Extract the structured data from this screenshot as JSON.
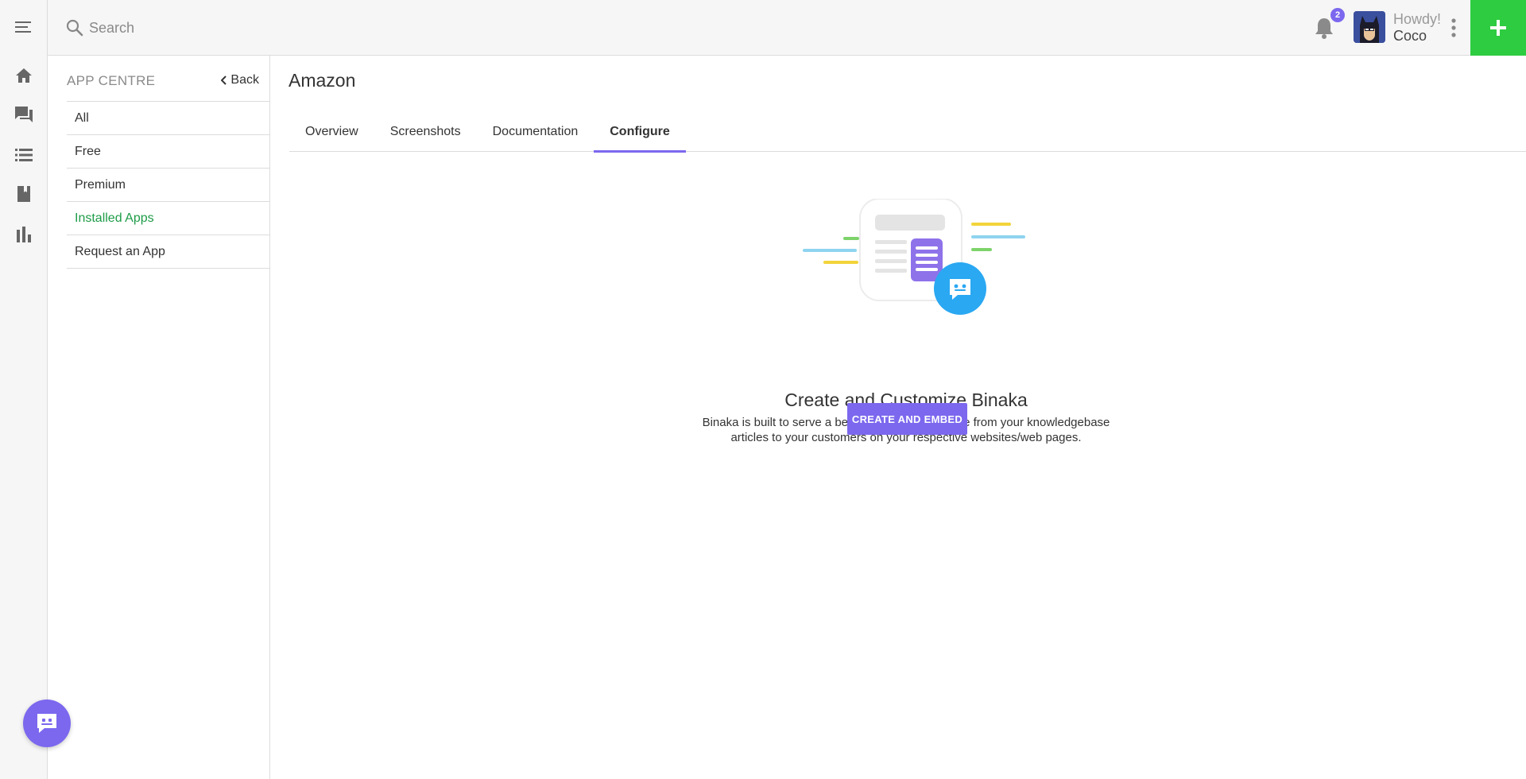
{
  "topbar": {
    "search_placeholder": "Search",
    "notification_count": "2",
    "greeting": "Howdy!",
    "username": "Coco",
    "icons": [
      "search-icon",
      "bell-icon",
      "avatar",
      "kebab-menu-icon",
      "plus-icon"
    ]
  },
  "rail": {
    "icons": [
      "hamburger-menu-icon",
      "home-icon",
      "chat-icon",
      "list-icon",
      "book-icon",
      "bar-chart-icon"
    ]
  },
  "subnav": {
    "title": "APP CENTRE",
    "back_label": "Back",
    "items": [
      {
        "label": "All"
      },
      {
        "label": "Free"
      },
      {
        "label": "Premium"
      },
      {
        "label": "Installed Apps",
        "active": true
      },
      {
        "label": "Request an App"
      }
    ]
  },
  "main": {
    "title": "Amazon",
    "tabs": [
      {
        "label": "Overview"
      },
      {
        "label": "Screenshots"
      },
      {
        "label": "Documentation"
      },
      {
        "label": "Configure",
        "active": true
      }
    ],
    "empty_state": {
      "title": "Create and Customize Binaka",
      "description_line1": "Binaka is built to serve a better support experience from your knowledgebase",
      "description_line2": "articles to your customers on your respective websites/web pages.",
      "button_label": "CREATE AND EMBED"
    }
  },
  "colors": {
    "accent": "#7b68ee",
    "add_button": "#2ecc40",
    "active_nav": "#1e9c48",
    "chat_bubble": "#2aa8f2"
  }
}
